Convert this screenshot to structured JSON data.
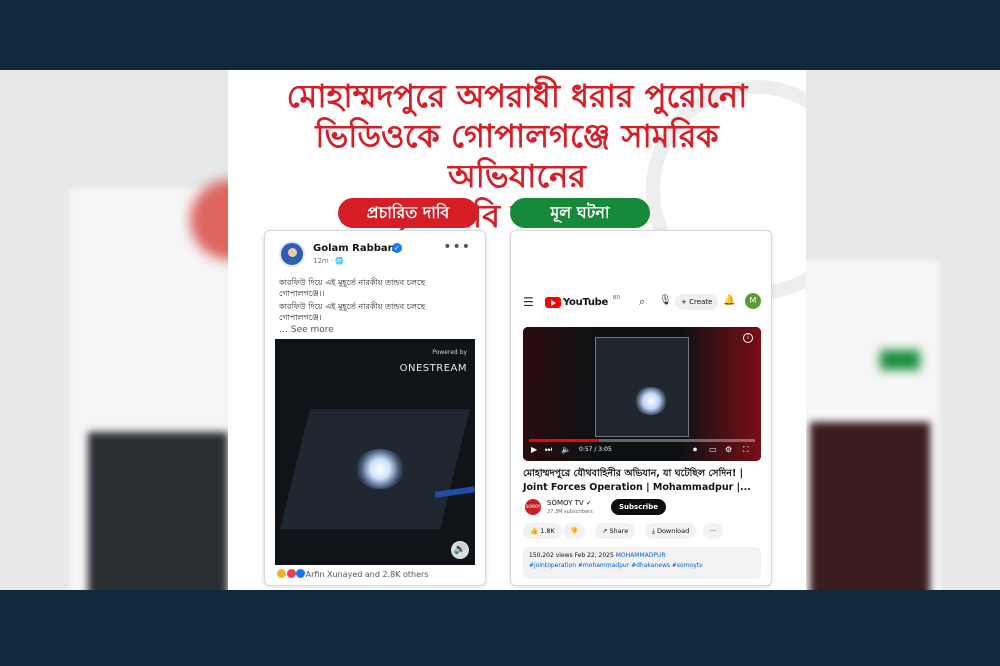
{
  "headline": {
    "line1": "মোহাম্মদপুরে অপরাধী ধরার পুরোনো",
    "line2": "ভিডিওকে গোপালগঞ্জে সামরিক অভিযানের",
    "line3": "দৃশ্য দাবি করে প্রচার"
  },
  "labels": {
    "claim": "প্রচারিত দাবি",
    "fact": "মূল ঘটনা"
  },
  "colors": {
    "headline_red": "#d71d25",
    "claim_pill": "#d71d25",
    "fact_pill": "#168a3a",
    "background_band": "#12283b"
  },
  "facebook_post": {
    "author": "Golam Rabbani",
    "verified_icon": "verified-badge-icon",
    "time": "12m · 🌐",
    "more_icon": "more-dots-icon",
    "text_line1": "কারফিউ দিয়ে এই মুহূর্তে নারকীয় তান্ডব চলছে গোপালগঞ্জে।।",
    "text_line2": "কারফিউ দিয়ে এই মুহূর্তে নারকীয় তান্ডব চলছে গোপালগঞ্জে।",
    "see_more": "… See more",
    "video": {
      "powered_by": "Powered by",
      "brand": "ONESTREAM",
      "sound_icon": "volume-icon"
    },
    "reactions": "Arfin Xunayed and 2.8K others"
  },
  "youtube": {
    "header": {
      "menu_icon": "hamburger-menu-icon",
      "logo_text": "YouTube",
      "logo_sup": "BD",
      "search_icon": "search-icon",
      "mic_icon": "mic-icon",
      "create_label": "+ Create",
      "bell_icon": "bell-icon",
      "avatar_letter": "M"
    },
    "player": {
      "time": "0:57 / 3:05",
      "progress": 0.31
    },
    "title": "মোহাম্মদপুরে যৌথবাহিনীর অভিযান, যা ঘটেছিল সেদিন! | Joint Forces Operation | Mohammadpur |...",
    "channel": {
      "logo_text": "SOMOY",
      "name": "SOMOY TV ✓",
      "subscribers": "27.3M subscribers",
      "subscribe_label": "Subscribe"
    },
    "actions": {
      "likes": "👍 1.8K",
      "dislike": "👎",
      "share": "↗ Share",
      "download": "⤓ Download",
      "more": "···"
    },
    "description": {
      "views_date": "150,202 views  Feb 22, 2025",
      "location_tag": "MOHAMMADPUR",
      "hashtags": "#jointoperation #mohammadpur #dhakanews #somoytv"
    }
  }
}
